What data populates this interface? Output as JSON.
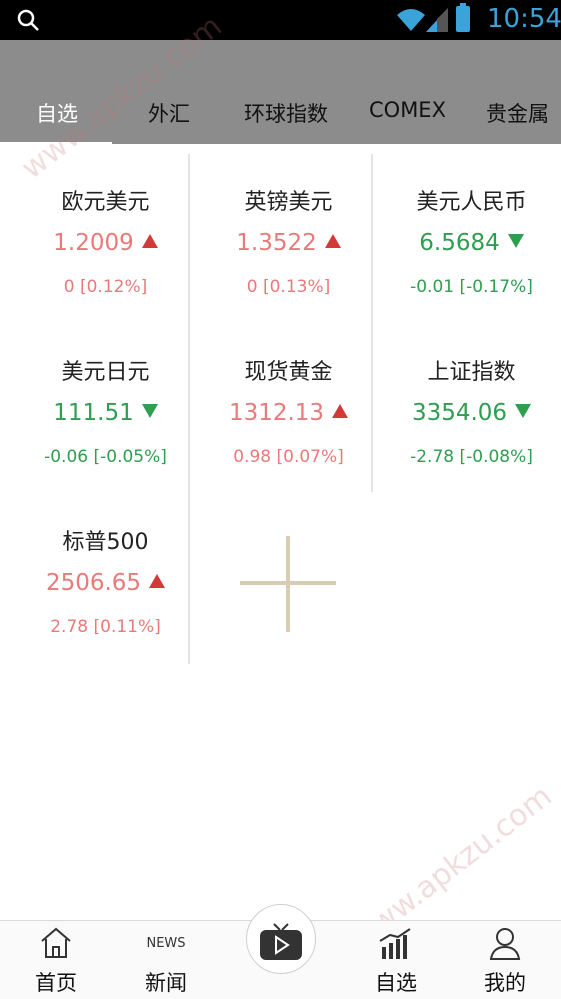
{
  "status_bar": {
    "time": "10:54"
  },
  "tabs": [
    {
      "label": "自选",
      "active": true
    },
    {
      "label": "外汇",
      "active": false
    },
    {
      "label": "环球指数",
      "active": false
    },
    {
      "label": "COMEX",
      "active": false
    },
    {
      "label": "贵金属",
      "active": false
    }
  ],
  "quotes": [
    {
      "name": "欧元美元",
      "price": "1.2009",
      "change": "0 [0.12%]",
      "direction": "up"
    },
    {
      "name": "英镑美元",
      "price": "1.3522",
      "change": "0 [0.13%]",
      "direction": "up"
    },
    {
      "name": "美元人民币",
      "price": "6.5684",
      "change": "-0.01 [-0.17%]",
      "direction": "down"
    },
    {
      "name": "美元日元",
      "price": "111.51",
      "change": "-0.06 [-0.05%]",
      "direction": "down"
    },
    {
      "name": "现货黄金",
      "price": "1312.13",
      "change": "0.98 [0.07%]",
      "direction": "up"
    },
    {
      "name": "上证指数",
      "price": "3354.06",
      "change": "-2.78 [-0.08%]",
      "direction": "down"
    },
    {
      "name": "标普500",
      "price": "2506.65",
      "change": "2.78 [0.11%]",
      "direction": "up"
    }
  ],
  "bottom_nav": [
    {
      "label": "首页",
      "icon": "home-icon"
    },
    {
      "label": "新闻",
      "icon": "news-icon",
      "icon_text": "NEWS"
    },
    {
      "label": "",
      "icon": "tv-play-icon"
    },
    {
      "label": "自选",
      "icon": "chart-icon"
    },
    {
      "label": "我的",
      "icon": "user-icon"
    }
  ],
  "watermark": "www.apkzu.com",
  "colors": {
    "up": "#e87a7a",
    "down": "#2e9e4f",
    "header_bg": "#8c8c8c",
    "accent": "#3aa3d9"
  }
}
